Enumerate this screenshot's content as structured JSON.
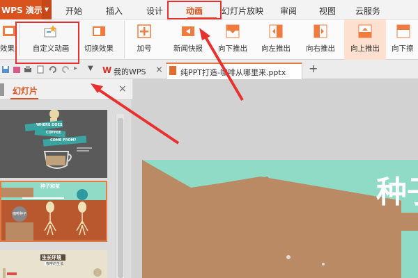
{
  "app": {
    "name": "WPS 演示",
    "dropdown_glyph": "▼"
  },
  "menu": [
    {
      "label": "开始"
    },
    {
      "label": "插入"
    },
    {
      "label": "设计"
    },
    {
      "label": "动画"
    },
    {
      "label": "幻灯片放映"
    },
    {
      "label": "审阅"
    },
    {
      "label": "视图"
    },
    {
      "label": "云服务"
    }
  ],
  "active_menu": "动画",
  "ribbon": {
    "partial_left_label": "效果",
    "custom_anim_label": "自定义动画",
    "transition_label": "切换效果",
    "effects": [
      {
        "label": "加号"
      },
      {
        "label": "新闻快报"
      },
      {
        "label": "向下推出"
      },
      {
        "label": "向左推出"
      },
      {
        "label": "向右推出"
      },
      {
        "label": "向上推出"
      },
      {
        "label": "向下擦"
      }
    ],
    "selected_effect": "向上推出"
  },
  "tabs": {
    "doc1_label": "我的WPS",
    "doc2_label": "纯PPT打造-咖啡从哪里来.pptx",
    "close_glyph": "×",
    "add_glyph": "+"
  },
  "left_panel": {
    "title": "幻灯片",
    "close_glyph": "×",
    "slide1": {
      "line1": "WHERE DOES",
      "line2": "COFFEE",
      "line3": "COME FROM?"
    },
    "slide2": {
      "title": "种子和苗",
      "badge": "咖啡种子"
    },
    "slide3": {
      "title": "生长环境",
      "subtitle": "咖啡的生长"
    }
  },
  "canvas": {
    "big_title": "种子"
  },
  "colors": {
    "accent": "#d9531e",
    "mint": "#8fdbc6",
    "arrow": "#e8312f",
    "box": "#e8312f"
  },
  "icons": [
    "undo-icon",
    "redo-icon",
    "save-icon",
    "print-icon",
    "plus-icon",
    "star-icon"
  ]
}
